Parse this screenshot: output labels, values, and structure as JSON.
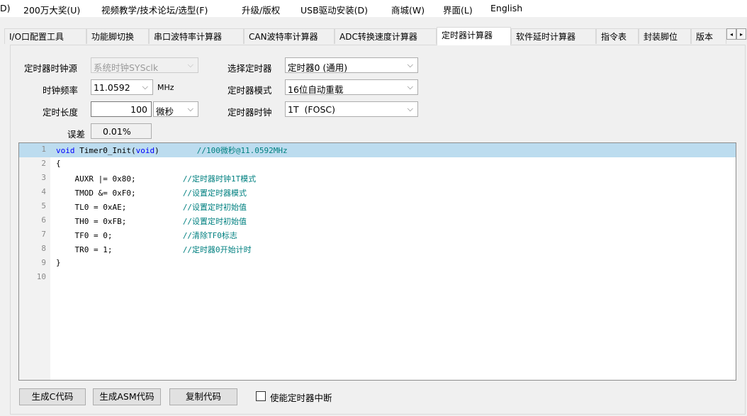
{
  "menu": [
    "D)",
    "200万大奖(U)",
    "视频教学/技术论坛/选型(F)",
    "升级/版权",
    "USB驱动安装(D)",
    "商城(W)",
    "界面(L)",
    "English"
  ],
  "tabs": [
    "I/O口配置工具",
    "功能脚切换",
    "串口波特率计算器",
    "CAN波特率计算器",
    "ADC转换速度计算器",
    "定时器计算器",
    "软件延时计算器",
    "指令表",
    "封装脚位",
    "版本"
  ],
  "selected_tab": "定时器计算器",
  "scroll_left": "◂",
  "scroll_right": "▸",
  "form": {
    "clock_source_label": "定时器时钟源",
    "clock_source_value": "系统时钟SYSclk",
    "clock_freq_label": "时钟频率",
    "clock_freq_value": "11.0592",
    "clock_freq_unit": "MHz",
    "timing_length_label": "定时长度",
    "timing_length_value": "100",
    "timing_unit_value": "微秒",
    "error_label": "误差",
    "error_value": "0.01%",
    "select_timer_label": "选择定时器",
    "select_timer_value": "定时器0 (通用)",
    "timer_mode_label": "定时器模式",
    "timer_mode_value": "16位自动重载",
    "timer_clock_label": "定时器时钟",
    "timer_clock_value": "1T  (FOSC)",
    "arrow": "⌵"
  },
  "code_lines": [
    {
      "num": "1",
      "kw": "void",
      "text": " Timer0_Init(",
      "kw2": "void",
      "text2": ")        ",
      "comment": "//100微秒@11.0592MHz"
    },
    {
      "num": "2",
      "text": "{"
    },
    {
      "num": "3",
      "text": "    AUXR |= 0x80;          ",
      "comment": "//定时器时钟1T模式"
    },
    {
      "num": "4",
      "text": "    TMOD &= 0xF0;          ",
      "comment": "//设置定时器模式"
    },
    {
      "num": "5",
      "text": "    TL0 = 0xAE;            ",
      "comment": "//设置定时初始值"
    },
    {
      "num": "6",
      "text": "    TH0 = 0xFB;            ",
      "comment": "//设置定时初始值"
    },
    {
      "num": "7",
      "text": "    TF0 = 0;               ",
      "comment": "//清除TF0标志"
    },
    {
      "num": "8",
      "text": "    TR0 = 1;               ",
      "comment": "//定时器0开始计时"
    },
    {
      "num": "9",
      "text": "}"
    },
    {
      "num": "10",
      "text": ""
    }
  ],
  "buttons": {
    "gen_c": "生成C代码",
    "gen_asm": "生成ASM代码",
    "copy": "复制代码"
  },
  "enable_interrupt_label": "使能定时器中断"
}
